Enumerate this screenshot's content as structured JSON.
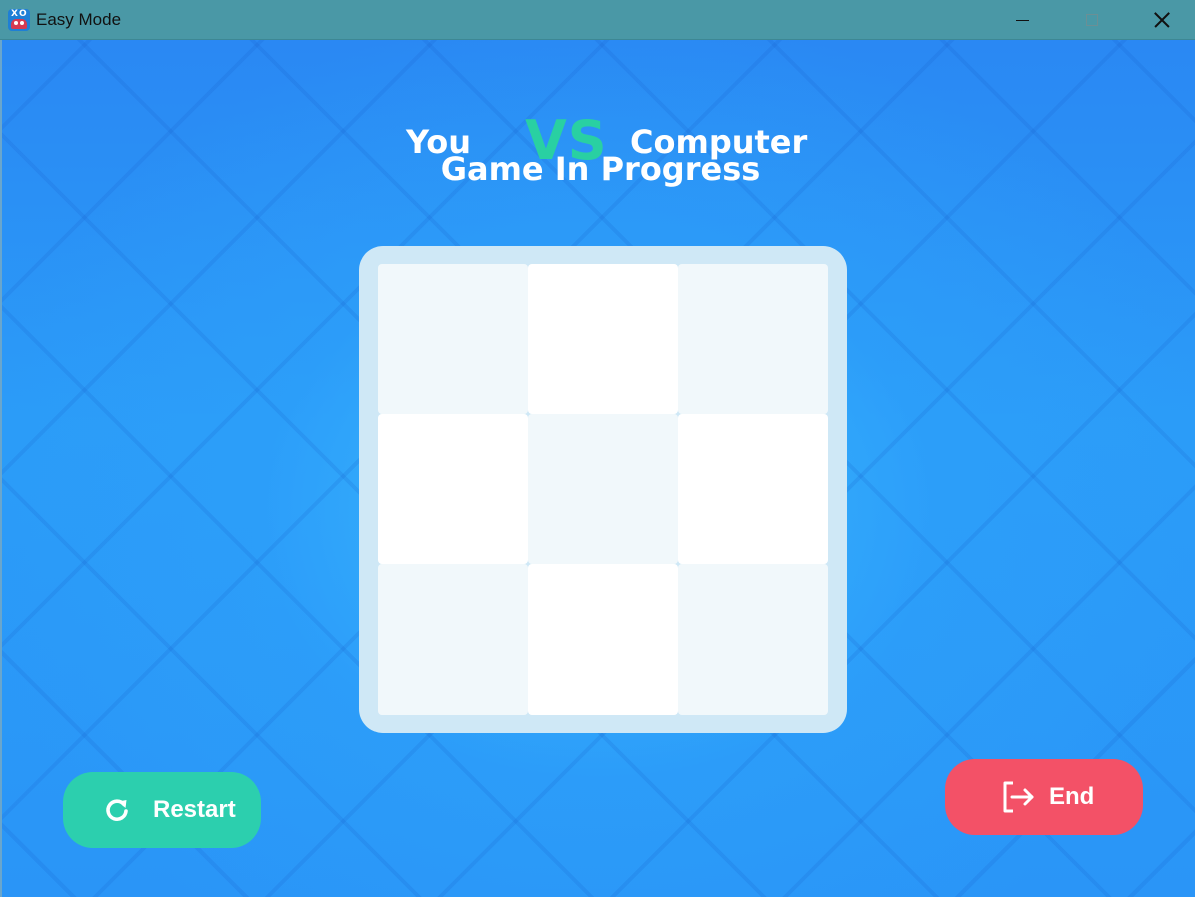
{
  "window": {
    "title": "Easy Mode",
    "app_icon": "tic-tac-toe-robot-icon",
    "controls": {
      "minimize": "minimize-icon",
      "maximize": "maximize-icon",
      "close": "close-icon"
    }
  },
  "header": {
    "player_left": "You",
    "versus": "VS",
    "player_right": "Computer",
    "status": "Game In Progress"
  },
  "board": {
    "rows": 3,
    "cols": 3,
    "cells": [
      "",
      "",
      "",
      "",
      "",
      "",
      "",
      "",
      ""
    ]
  },
  "buttons": {
    "restart": {
      "label": "Restart",
      "icon": "restart-icon"
    },
    "end": {
      "label": "End",
      "icon": "exit-icon"
    }
  },
  "colors": {
    "titlebar": "#4a98a6",
    "background": "#2a8cf2",
    "accent_vs": "#29d0a2",
    "restart_button": "#2ccfae",
    "end_button": "#f35167",
    "board_frame": "#cfe8f6",
    "cell_light": "#f1f8fb",
    "cell_white": "#ffffff"
  }
}
